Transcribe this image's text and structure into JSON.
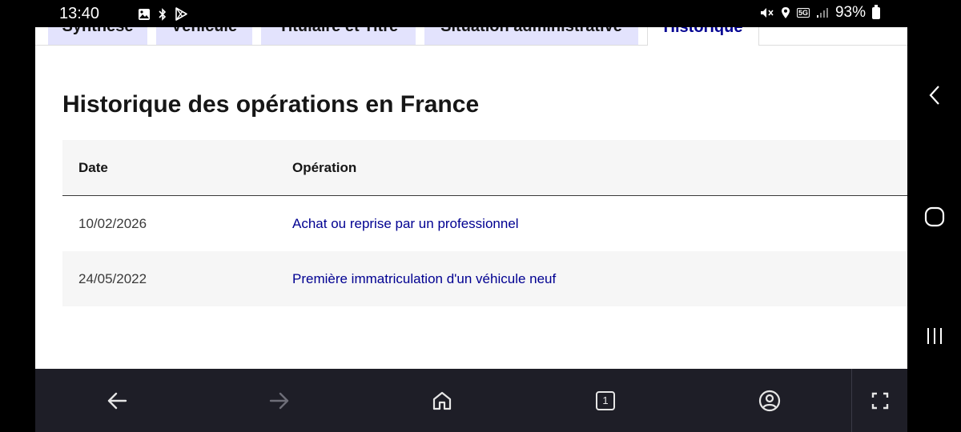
{
  "status_bar": {
    "time": "13:40",
    "network": "5G",
    "battery": "93%"
  },
  "tabs": [
    {
      "label": "Synthèse"
    },
    {
      "label": "Véhicule"
    },
    {
      "label": "Titulaire et Titre"
    },
    {
      "label": "Situation administrative"
    },
    {
      "label": "Historique",
      "active": true
    }
  ],
  "page": {
    "heading": "Historique des opérations en France"
  },
  "table": {
    "headers": {
      "date": "Date",
      "operation": "Opération"
    },
    "rows": [
      {
        "date": "10/02/2026",
        "operation": "Achat ou reprise par un professionnel"
      },
      {
        "date": "24/05/2022",
        "operation": "Première immatriculation d'un véhicule neuf"
      }
    ]
  },
  "bottom_nav": {
    "tab_count": "1"
  },
  "colors": {
    "accent": "#000091",
    "tab_background": "#e3e3fd",
    "navbar": "#1e1e27"
  }
}
